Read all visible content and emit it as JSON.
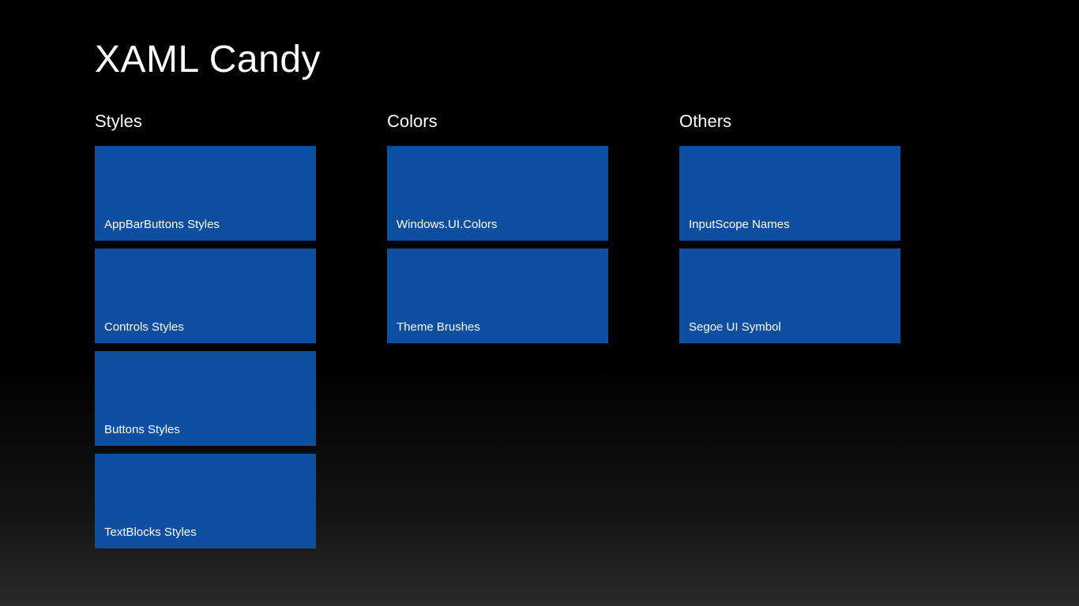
{
  "title": "XAML Candy",
  "tile_color": "#0e4ea0",
  "groups": [
    {
      "header": "Styles",
      "tiles": [
        {
          "label": "AppBarButtons Styles"
        },
        {
          "label": "Controls Styles"
        },
        {
          "label": "Buttons Styles"
        },
        {
          "label": "TextBlocks Styles"
        }
      ]
    },
    {
      "header": "Colors",
      "tiles": [
        {
          "label": "Windows.UI.Colors"
        },
        {
          "label": "Theme Brushes"
        }
      ]
    },
    {
      "header": "Others",
      "tiles": [
        {
          "label": "InputScope Names"
        },
        {
          "label": "Segoe UI Symbol"
        }
      ]
    }
  ]
}
